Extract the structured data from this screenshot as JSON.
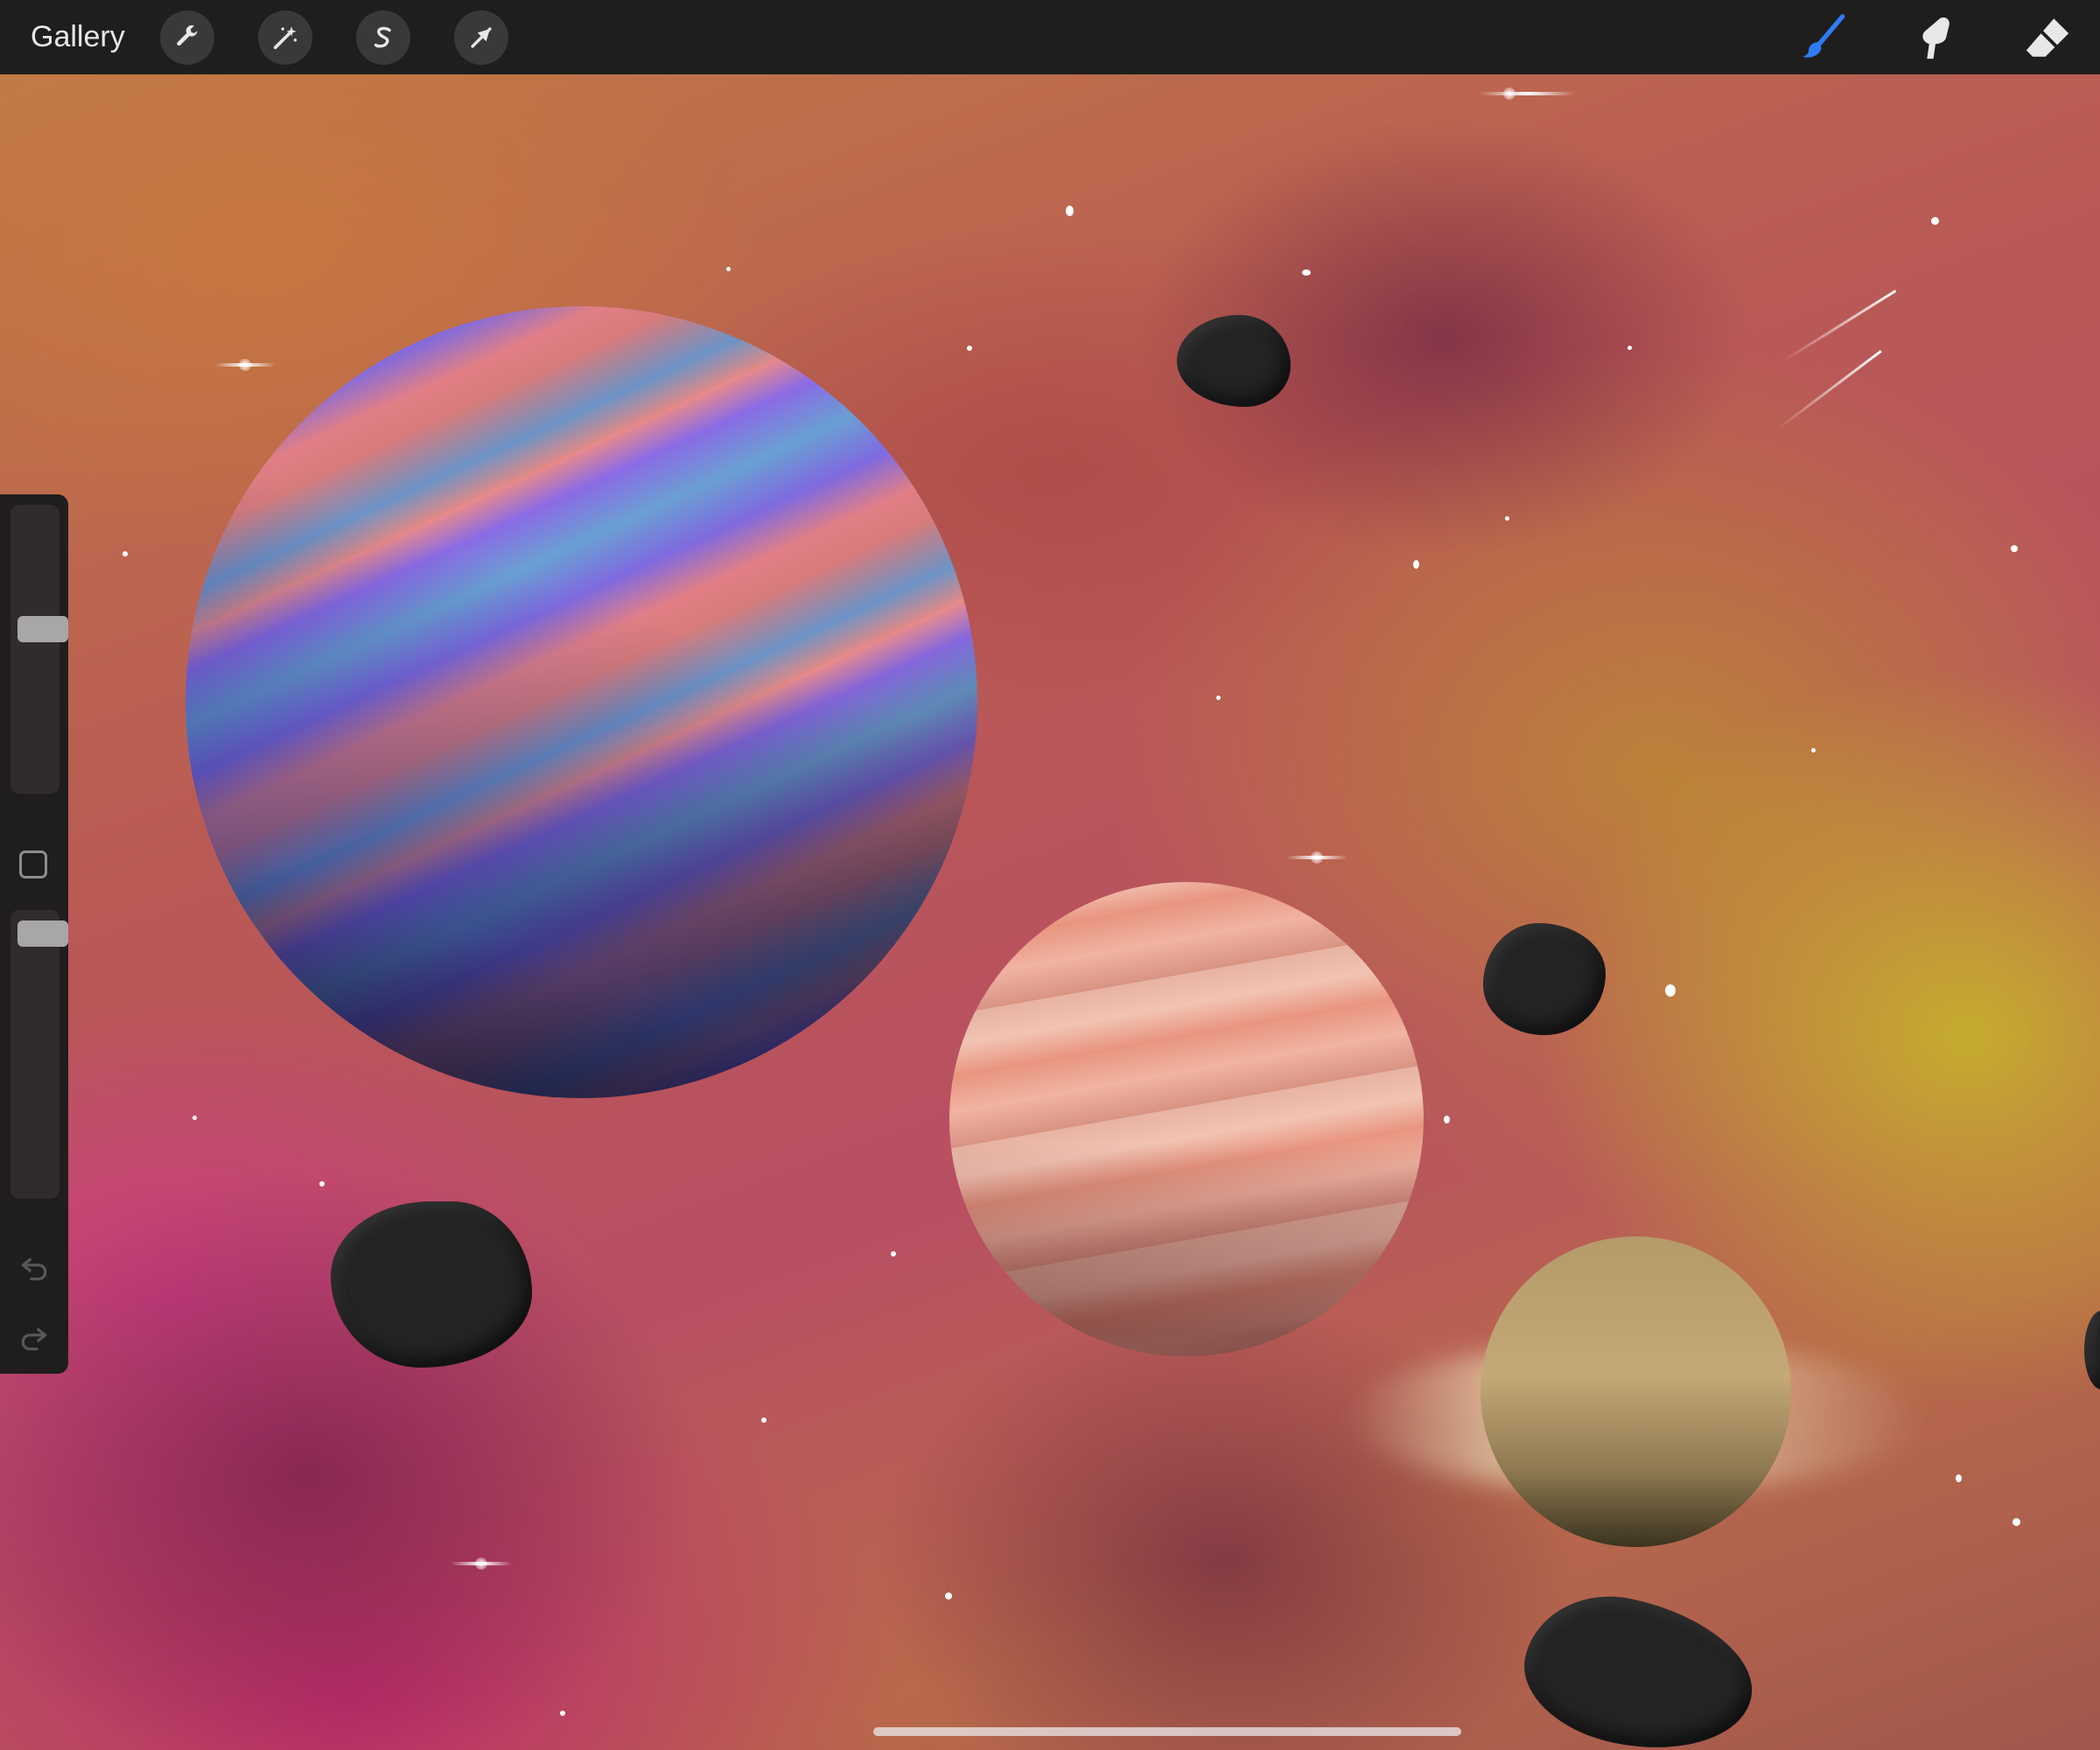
{
  "topbar": {
    "gallery_label": "Gallery",
    "left_tools": [
      {
        "name": "actions",
        "icon": "wrench-icon"
      },
      {
        "name": "adjustments",
        "icon": "magic-wand-icon"
      },
      {
        "name": "selection",
        "icon": "selection-s-icon"
      },
      {
        "name": "transform",
        "icon": "arrow-cursor-icon"
      }
    ],
    "right_tools": [
      {
        "name": "brush",
        "icon": "brush-icon",
        "active": true
      },
      {
        "name": "smudge",
        "icon": "smudge-finger-icon"
      },
      {
        "name": "eraser",
        "icon": "eraser-icon"
      }
    ]
  },
  "sidebar": {
    "brush_size_level": 0.58,
    "opacity_level": 0.98,
    "modify_button_icon": "square-icon",
    "undo_icon": "undo-arrow-icon",
    "redo_icon": "redo-arrow-icon"
  },
  "colors": {
    "toolbar_bg": "#1f1e1d",
    "active_brush": "#2f7bf5",
    "icon_color": "#e8e8e8"
  }
}
